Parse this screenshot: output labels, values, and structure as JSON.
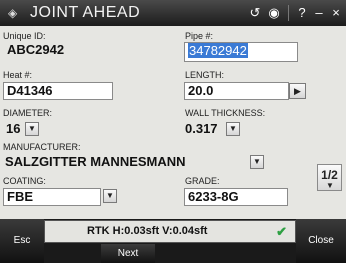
{
  "titlebar": {
    "title": "JOINT AHEAD",
    "logo_glyph": "◈",
    "back_glyph": "↺",
    "gps_glyph": "◉",
    "help_label": "?",
    "minimize_label": "–",
    "close_label": "×"
  },
  "form": {
    "unique_id": {
      "label": "Unique ID:",
      "value": "ABC2942"
    },
    "pipe": {
      "label": "Pipe #:",
      "value": "34782942"
    },
    "heat": {
      "label": "Heat #:",
      "value": "D41346"
    },
    "length": {
      "label": "LENGTH:",
      "value": "20.0"
    },
    "diameter": {
      "label": "DIAMETER:",
      "value": "16"
    },
    "wall_thickness": {
      "label": "WALL THICKNESS:",
      "value": "0.317"
    },
    "manufacturer": {
      "label": "MANUFACTURER:",
      "value": "SALZGITTER MANNESMANN"
    },
    "coating": {
      "label": "COATING:",
      "value": "FBE"
    },
    "grade": {
      "label": "GRADE:",
      "value": "6233-8G"
    },
    "page": {
      "label": "1/2",
      "down_glyph": "▼"
    },
    "dropdown_glyph": "▼",
    "right_arrow_glyph": "▶"
  },
  "bottom": {
    "esc_label": "Esc",
    "next_label": "Next",
    "close_label": "Close",
    "status_text": "RTK H:0.03sft V:0.04sft",
    "status_check": "✔"
  },
  "colors": {
    "selection": "#3a7ad5",
    "status_ok": "#2ea043",
    "titlebar": "#2a2a2a"
  }
}
